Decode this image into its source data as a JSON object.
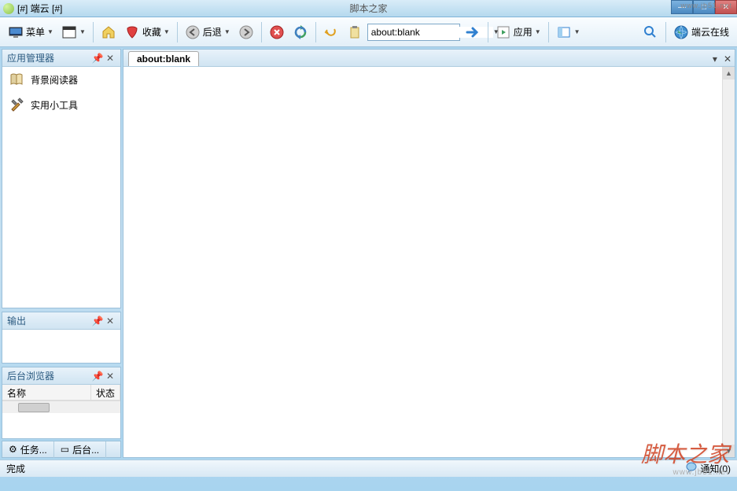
{
  "window": {
    "title": "[#] 端云 [#]",
    "mid_banner": "脚本之家",
    "top_url_watermark": "www.jb51.net"
  },
  "toolbar": {
    "menu_label": "菜单",
    "favorites_label": "收藏",
    "back_label": "后退",
    "apply_label": "应用",
    "address_value": "about:blank",
    "online_label": "端云在线"
  },
  "sidebar": {
    "app_manager": {
      "title": "应用管理器",
      "items": [
        {
          "label": "背景阅读器",
          "icon": "book"
        },
        {
          "label": "实用小工具",
          "icon": "tools"
        }
      ]
    },
    "output": {
      "title": "输出"
    },
    "bg_browser": {
      "title": "后台浏览器",
      "col_name": "名称",
      "col_status": "状态"
    },
    "tabs": {
      "tasks": "任务...",
      "background": "后台..."
    }
  },
  "content": {
    "tab_label": "about:blank"
  },
  "status": {
    "left": "完成",
    "notify": "通知(0)"
  },
  "watermark": {
    "text": "脚本之家",
    "url": "www.jb51.net"
  }
}
